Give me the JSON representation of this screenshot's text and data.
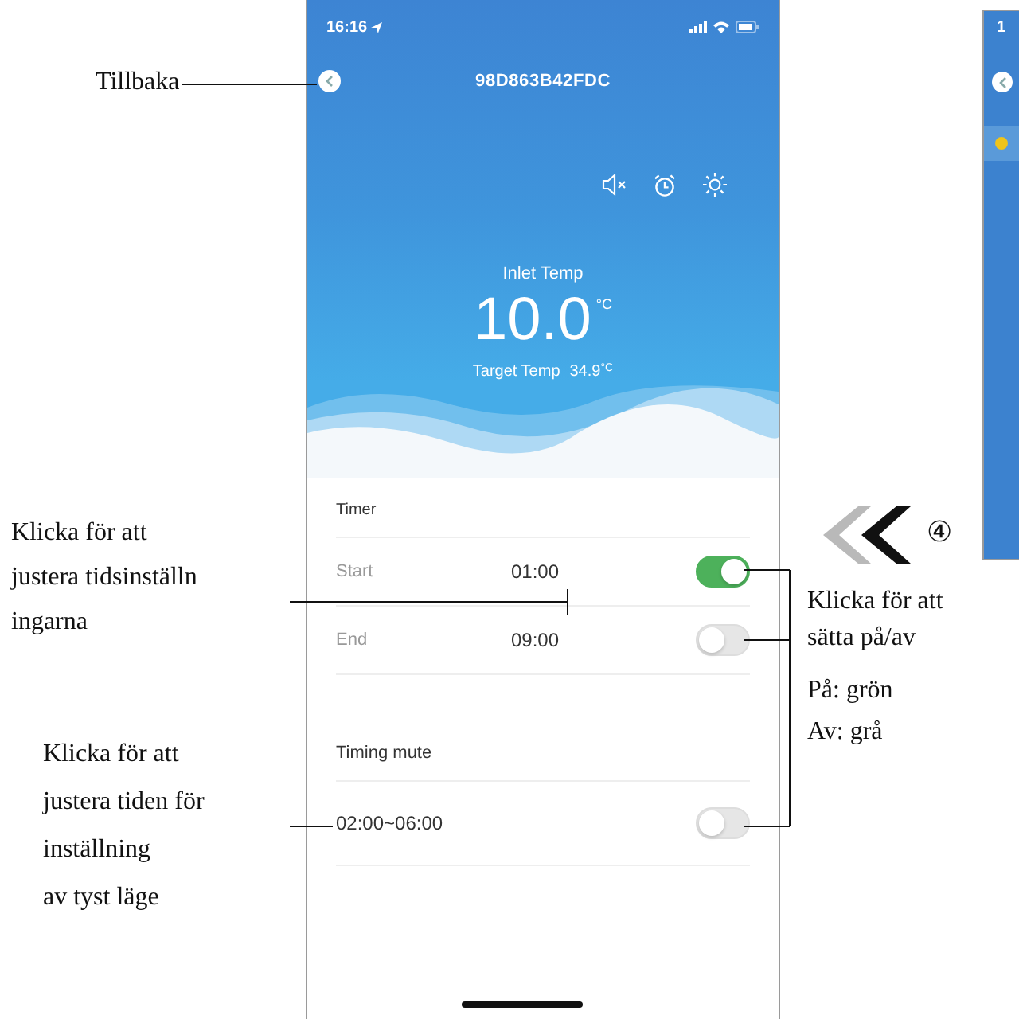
{
  "phone": {
    "status_time": "16:16",
    "title": "98D863B42FDC",
    "inlet_label": "Inlet Temp",
    "inlet_value": "10.0",
    "inlet_unit": "°C",
    "target_label": "Target Temp",
    "target_value": "34.9",
    "target_unit": "°C",
    "timer_title": "Timer",
    "timer_rows": [
      {
        "label": "Start",
        "time": "01:00",
        "on": true
      },
      {
        "label": "End",
        "time": "09:00",
        "on": false
      }
    ],
    "mute_title": "Timing mute",
    "mute_rows": [
      {
        "range": "02:00~06:00",
        "on": false
      }
    ]
  },
  "second_phone": {
    "status_time": "1"
  },
  "annotations": {
    "back": "Tillbaka",
    "timer_hint": [
      "Klicka för att",
      "justera tidsinställn",
      "ingarna"
    ],
    "mute_hint": [
      "Klicka för att",
      "justera tiden för",
      "inställning",
      "av tyst läge"
    ],
    "toggle_hint": [
      "Klicka för att",
      "sätta på/av"
    ],
    "legend": [
      "På: grön",
      "Av: grå"
    ],
    "step": "④"
  }
}
